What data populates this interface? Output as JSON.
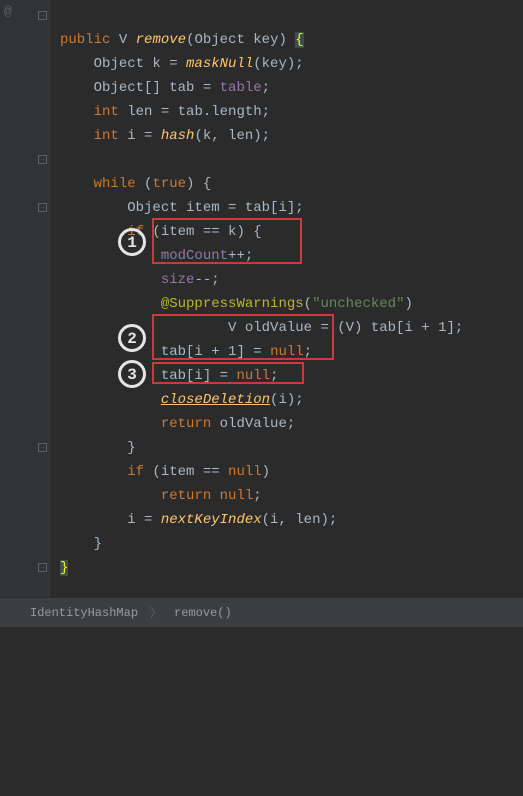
{
  "code": {
    "l1_kw1": "public",
    "l1_type": "V",
    "l1_method": "remove",
    "l1_param": "(Object key) ",
    "l1_brace": "{",
    "l2": "Object k = ",
    "l2_m": "maskNull",
    "l2_e": "(key);",
    "l3_a": "Object[] tab = ",
    "l3_f": "table",
    "l3_e": ";",
    "l4_kw": "int",
    "l4_a": " len = tab.length;",
    "l5_kw": "int",
    "l5_a": " i = ",
    "l5_m": "hash",
    "l5_e": "(k, len);",
    "l7_kw": "while",
    "l7_a": " (",
    "l7_kw2": "true",
    "l7_e": ") {",
    "l8": "Object item = tab[i];",
    "l9_kw": "if",
    "l9_a": " (item == k) {",
    "l10_f": "modCount",
    "l10_e": "++;",
    "l11_f": "size",
    "l11_e": "--;",
    "l12_anno": "@SuppressWarnings",
    "l12_a": "(",
    "l12_str": "\"unchecked\"",
    "l12_e": ")",
    "l13_a": "V oldValue = (V) tab[i + ",
    "l13_n": "1",
    "l13_e": "];",
    "l14_a": "tab[i + ",
    "l14_n": "1",
    "l14_b": "] = ",
    "l14_kw": "null",
    "l14_e": ";",
    "l15_a": "tab[i] = ",
    "l15_kw": "null",
    "l15_e": ";",
    "l16_m": "closeDeletion",
    "l16_e": "(i);",
    "l17_kw": "return",
    "l17_a": " oldValue;",
    "l18": "}",
    "l19_kw": "if",
    "l19_a": " (item == ",
    "l19_kw2": "null",
    "l19_e": ")",
    "l20_kw": "return",
    "l20_a": " ",
    "l20_kw2": "null",
    "l20_e": ";",
    "l21_a": "i = ",
    "l21_m": "nextKeyIndex",
    "l21_e": "(i, len);",
    "l22": "}",
    "l23": "}"
  },
  "annotations": {
    "c1": "1",
    "c2": "2",
    "c3": "3"
  },
  "breadcrumb": {
    "class": "IdentityHashMap",
    "method": "remove()"
  },
  "gutter_at": "@"
}
